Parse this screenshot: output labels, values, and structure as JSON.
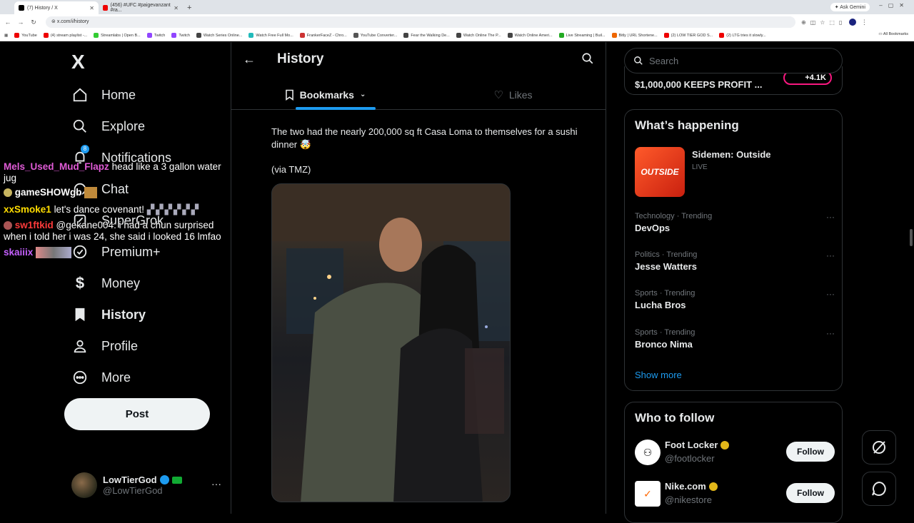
{
  "browser": {
    "tabs": [
      {
        "title": "(7) History / X",
        "active": true
      },
      {
        "title": "(456) #UFC #paigevanzant #ra...",
        "active": false
      }
    ],
    "ask_gemini": "Ask Gemini",
    "url": "x.com/i/history",
    "bookmarks": [
      "YouTube",
      "(4) stream playlist -...",
      "Streamlabs | Open B...",
      "Twitch",
      "Twitch",
      "Watch Series Online...",
      "Watch Free Full Mo...",
      "FrankerFaceZ - Chro...",
      "YouTube Converter...",
      "Fear the Walking De...",
      "Watch Online The P...",
      "Watch Online Ameri...",
      "Live Streaming | Buil...",
      "Bitly | URL Shortene...",
      "(2) LOW TIER GOD S...",
      "(2) LTG tries it slowly..."
    ],
    "all_bookmarks": "All Bookmarks"
  },
  "nav": {
    "logo": "X",
    "items": [
      {
        "label": "Home"
      },
      {
        "label": "Explore"
      },
      {
        "label": "Notifications",
        "badge": "8"
      },
      {
        "label": "Chat"
      },
      {
        "label": "SuperGrok"
      },
      {
        "label": "Premium+"
      },
      {
        "label": "Money"
      },
      {
        "label": "History"
      },
      {
        "label": "Profile"
      },
      {
        "label": "More"
      }
    ],
    "post_label": "Post",
    "profile": {
      "name": "LowTierGod",
      "handle": "@LowTierGod",
      "more": "···"
    }
  },
  "chat_overlay": [
    {
      "user": "Mels_Used_Mud_Flapz",
      "msg": "head like a 3 gallon water"
    },
    {
      "user": "",
      "msg": "jug"
    },
    {
      "user": "gameSHOWgb",
      "msg": ""
    },
    {
      "user": "xxSmoke1",
      "msg": "let's dance covenant!"
    },
    {
      "user": "sw1ftkid",
      "msg": "@gekane004: i had a chun surprised"
    },
    {
      "user": "",
      "msg": "when i told her i was 24, she said i looked 16 lmfao"
    },
    {
      "user": "skaiiix",
      "msg": ""
    }
  ],
  "center": {
    "title": "History",
    "tabs": [
      {
        "label": "Bookmarks",
        "active": true
      },
      {
        "label": "Likes",
        "active": false
      }
    ],
    "tweet": {
      "text1": "The two had the nearly 200,000 sq ft Casa Loma to themselves for a sushi dinner 🤯",
      "text2": "(via TMZ)"
    }
  },
  "right": {
    "search_placeholder": "Search",
    "promo_text": "$1,000,000 KEEPS PROFIT ...",
    "promo_pill": "+4.1K",
    "whats_happening": {
      "title": "What’s happening",
      "event": {
        "name": "Sidemen: Outside",
        "status": "LIVE",
        "image_text": "OUTSIDE"
      },
      "trends": [
        {
          "meta": "Technology · Trending",
          "name": "DevOps"
        },
        {
          "meta": "Politics · Trending",
          "name": "Jesse Watters"
        },
        {
          "meta": "Sports · Trending",
          "name": "Lucha Bros"
        },
        {
          "meta": "Sports · Trending",
          "name": "Bronco Nima"
        }
      ],
      "show_more": "Show more"
    },
    "who_to_follow": {
      "title": "Who to follow",
      "accounts": [
        {
          "name": "Foot Locker",
          "handle": "@footlocker",
          "button": "Follow"
        },
        {
          "name": "Nike.com",
          "handle": "@nikestore",
          "button": "Follow"
        }
      ]
    }
  }
}
